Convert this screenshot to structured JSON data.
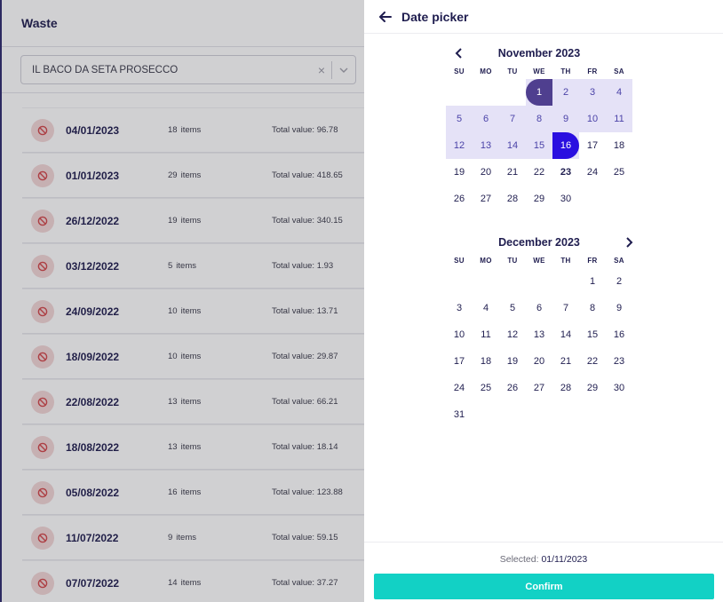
{
  "page": {
    "title": "Waste"
  },
  "filter": {
    "value": "IL BACO DA SETA PROSECCO",
    "clear_icon": "close-icon",
    "arrow_icon": "chevron-down-icon"
  },
  "list": {
    "items_label": "items",
    "total_label": "Total value:",
    "rows": [
      {
        "date": "04/01/2023",
        "count": "18",
        "total": "96.78"
      },
      {
        "date": "01/01/2023",
        "count": "29",
        "total": "418.65"
      },
      {
        "date": "26/12/2022",
        "count": "19",
        "total": "340.15"
      },
      {
        "date": "03/12/2022",
        "count": "5",
        "total": "1.93"
      },
      {
        "date": "24/09/2022",
        "count": "10",
        "total": "13.71"
      },
      {
        "date": "18/09/2022",
        "count": "10",
        "total": "29.87"
      },
      {
        "date": "22/08/2022",
        "count": "13",
        "total": "66.21"
      },
      {
        "date": "18/08/2022",
        "count": "13",
        "total": "18.14"
      },
      {
        "date": "05/08/2022",
        "count": "16",
        "total": "123.88"
      },
      {
        "date": "11/07/2022",
        "count": "9",
        "total": "59.15"
      },
      {
        "date": "07/07/2022",
        "count": "14",
        "total": "37.27"
      }
    ]
  },
  "picker": {
    "title": "Date picker",
    "weekdays": [
      "SU",
      "MO",
      "TU",
      "WE",
      "TH",
      "FR",
      "SA"
    ],
    "months": [
      {
        "label": "November 2023",
        "first_weekday": 3,
        "days": 30,
        "range_start": 1,
        "range_end": 16,
        "today": 23
      },
      {
        "label": "December 2023",
        "first_weekday": 5,
        "days": 31
      }
    ],
    "selected_label": "Selected:",
    "selected_value": "01/11/2023",
    "confirm_label": "Confirm"
  },
  "colors": {
    "accent": "#12d1c5",
    "range": "#e5e2f7",
    "start": "#4f3f8f",
    "end": "#2a0fe0",
    "text": "#1f1d4f"
  }
}
